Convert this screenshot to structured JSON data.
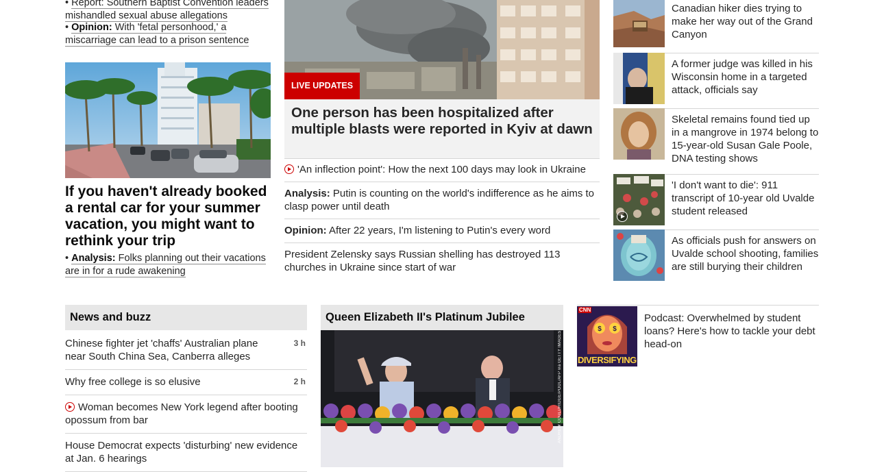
{
  "left": {
    "bullets_top": [
      {
        "prefix": "",
        "text": "Report: Southern Baptist Convention leaders mishandled sexual abuse allegations"
      },
      {
        "prefix": "Opinion:",
        "text": "With 'fetal personhood,' a miscarriage can lead to a prison sentence"
      }
    ],
    "main_headline": "If you haven't already booked a rental car for your summer vacation, you might want to rethink your trip",
    "bullet_bottom": {
      "prefix": "Analysis:",
      "text": "Folks planning out their vacations are in for a rude awakening"
    }
  },
  "center": {
    "badge": "LIVE UPDATES",
    "headline": "One person has been hospitalized after multiple blasts were reported in Kyiv at dawn",
    "rows": [
      {
        "prefix": "",
        "text": "'An inflection point': How the next 100 days may look in Ukraine",
        "video": true
      },
      {
        "prefix": "Analysis:",
        "text": "Putin is counting on the world's indifference as he aims to clasp power until death",
        "video": false
      },
      {
        "prefix": "Opinion:",
        "text": "After 22 years, I'm listening to Putin's every word",
        "video": false
      },
      {
        "prefix": "",
        "text": "President Zelensky says Russian shelling has destroyed 113 churches in Ukraine since start of war",
        "video": false
      }
    ]
  },
  "right": {
    "items": [
      {
        "text": "Canadian hiker dies trying to make her way out of the Grand Canyon",
        "icon": "canyon-photo"
      },
      {
        "text": "A former judge was killed in his Wisconsin home in a targeted attack, officials say",
        "icon": "judge-photo"
      },
      {
        "text": "Skeletal remains found tied up in a mangrove in 1974 belong to 15-year-old Susan Gale Poole, DNA testing shows",
        "icon": "portrait-photo"
      },
      {
        "text": "'I don't want to die': 911 transcript of 10-year old Uvalde student released",
        "icon": "vigil-photo"
      },
      {
        "text": "As officials push for answers on Uvalde school shooting, families are still burying their children",
        "icon": "memorial-photo"
      }
    ]
  },
  "news_buzz": {
    "title": "News and buzz",
    "rows": [
      {
        "text": "Chinese fighter jet 'chaffs' Australian plane near South China Sea, Canberra alleges",
        "time": "3 h",
        "video": false
      },
      {
        "text": "Why free college is so elusive",
        "time": "2 h",
        "video": false
      },
      {
        "text": "Woman becomes New York legend after booting opossum from bar",
        "time": "",
        "video": true
      },
      {
        "text": "House Democrat expects 'disturbing' new evidence at Jan. 6 hearings",
        "time": "",
        "video": false
      }
    ]
  },
  "jubilee": {
    "title": "Queen Elizabeth II's Platinum Jubilee",
    "photo_credit": "ANDREW COULDRIDGE/POOL/AFP via GETTY IMAGES"
  },
  "podcast": {
    "brand": "CNN",
    "show": "DIVERSIFYING",
    "text": "Podcast: Overwhelmed by student loans? Here's how to tackle your debt head-on"
  },
  "colors": {
    "accent_red": "#cc0000",
    "text": "#262626",
    "divider": "#d5d5d5"
  }
}
